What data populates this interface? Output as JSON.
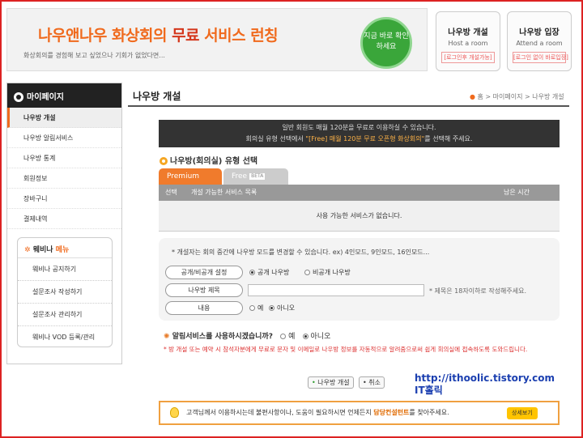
{
  "banner": {
    "title_part1": "나우앤나우 화상회의 ",
    "title_free": "무료",
    "title_part2": " 서비스 런칭",
    "subtitle": "화상회의를 경험해 보고 싶었으나 기회가 없었다면...",
    "cta": "지금 바로 확인하세요"
  },
  "cards": [
    {
      "title": "나우방 개설",
      "sub": "Host a room",
      "note": "[로그인후 개설가능]"
    },
    {
      "title": "나우방 입장",
      "sub": "Attend a room",
      "note": "[로그인 없이 바로입장]"
    }
  ],
  "sidebar": {
    "heading": "마이페이지",
    "items": [
      "나우방 개설",
      "나우방 알림서비스",
      "나우방 통계",
      "회원정보",
      "장바구니",
      "결제내역"
    ],
    "webinar_heading_a": "웨비나 ",
    "webinar_heading_b": "메뉴",
    "webinar_items": [
      "웨비나 공지하기",
      "설문조사 작성하기",
      "설문조사 관리하기",
      "웨비나 VOD 등록/관리"
    ]
  },
  "page": {
    "title": "나우방 개설",
    "breadcrumb": "홈 > 마이페이지 > 나우방 개설"
  },
  "notice": {
    "line1": "일반 회원도 매월 120분을 무료로 이용하실 수 있습니다.",
    "line2_pre": "회의실 유형 선택에서 ",
    "line2_hl": "\"[Free] 매월 120분 무료 오픈형 화상회의\"",
    "line2_post": "를 선택해 주세요."
  },
  "section": {
    "title": "나우방(회의실) 유형 선택",
    "tab_premium": "Premium",
    "tab_free": "Free",
    "tab_free_badge": "BETA",
    "col_select": "선택",
    "col_services": "개설 가능한 서비스 목록",
    "col_remaining": "남은 시간",
    "empty": "사용 가능한 서비스가 없습니다."
  },
  "form": {
    "desc": "* 개설자는 회의 중간에 나우방 모드를 변경할 수 있습니다. ex) 4인모드, 9인모드, 16인모드...",
    "visibility_label": "공개/비공개 설정",
    "visibility_public": "공개 나우방",
    "visibility_private": "비공개 나우방",
    "name_label": "나우방 제목",
    "name_value": "",
    "name_hint": "* 제목은 18자이하로 작성해주세요.",
    "content_label": "내용",
    "content_yes": "예",
    "content_no": "아니오"
  },
  "alarm": {
    "question": "알림서비스를 사용하시겠습니까?",
    "yes": "예",
    "no": "아니오",
    "warning": "* 방 개설 또는 예약 시 참석자분에게 무료로 문자 및 이메일로 나우방 정보를 자동적으로 알려줌으로써 쉽게 회의실에 접속하도록 도와드립니다."
  },
  "buttons": {
    "open": "나우방 개설",
    "cancel": "취소"
  },
  "watermark": {
    "url": "http://ithoolic.tistory.com",
    "name": "IT홀릭"
  },
  "help": {
    "pre": "고객님께서 이용하시는데 불편사항이나, 도움이 필요하시면 언제든지 ",
    "hl": "담당컨설턴트",
    "post": "를 찾아주세요.",
    "detail": "상세보기"
  }
}
